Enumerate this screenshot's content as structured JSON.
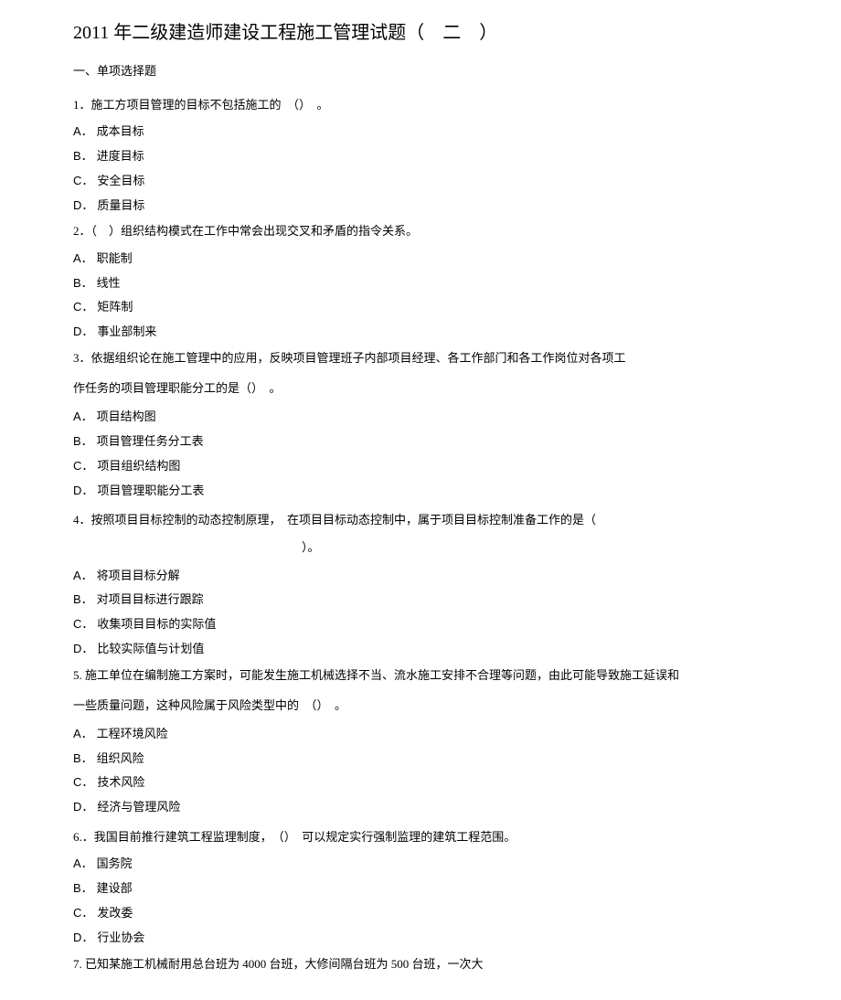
{
  "title": "2011 年二级建造师建设工程施工管理试题（　二　）",
  "section_heading": "一、单项选择题",
  "questions": [
    {
      "text": "1．施工方项目管理的目标不包括施工的　（）　。",
      "options": [
        {
          "letter": "A．",
          "text": "成本目标"
        },
        {
          "letter": "B．",
          "text": "进度目标"
        },
        {
          "letter": "C．",
          "text": "安全目标"
        },
        {
          "letter": "D．",
          "text": "质量目标"
        }
      ]
    },
    {
      "text": "2．（　）组织结构模式在工作中常会出现交叉和矛盾的指令关系。",
      "options": [
        {
          "letter": "A．",
          "text": "职能制"
        },
        {
          "letter": "B．",
          "text": "线性"
        },
        {
          "letter": "C．",
          "text": "矩阵制"
        },
        {
          "letter": "D．",
          "text": "事业部制来"
        }
      ]
    },
    {
      "text": "3．依据组织论在施工管理中的应用，反映项目管理班子内部项目经理、各工作部门和各工作岗位对各项工",
      "continuation": "作任务的项目管理职能分工的是（）　。",
      "options": [
        {
          "letter": "A．",
          "text": "项目结构图"
        },
        {
          "letter": "B．",
          "text": "项目管理任务分工表"
        },
        {
          "letter": "C．",
          "text": "项目组织结构图"
        },
        {
          "letter": "D．",
          "text": "项目管理职能分工表"
        }
      ]
    },
    {
      "text": "4．按照项目目标控制的动态控制原理，　在项目目标动态控制中，属于项目目标控制准备工作的是（",
      "blank_line": "）。",
      "options": [
        {
          "letter": "A．",
          "text": "将项目目标分解"
        },
        {
          "letter": "B．",
          "text": "对项目目标进行跟踪"
        },
        {
          "letter": "C．",
          "text": "收集项目目标的实际值"
        },
        {
          "letter": "D．",
          "text": "比较实际值与计划值"
        }
      ]
    },
    {
      "text": "5. 施工单位在编制施工方案时，可能发生施工机械选择不当、流水施工安排不合理等问题，由此可能导致施工延误和",
      "continuation": "一些质量问题，这种风险属于风险类型中的　（）　。",
      "options": [
        {
          "letter": "A．",
          "text": "工程环境风险"
        },
        {
          "letter": "B．",
          "text": "组织风险"
        },
        {
          "letter": "C．",
          "text": "技术风险"
        },
        {
          "letter": "D．",
          "text": "经济与管理风险"
        }
      ]
    },
    {
      "text": "6.．我国目前推行建筑工程监理制度，　（）　可以规定实行强制监理的建筑工程范围。",
      "options": [
        {
          "letter": "A．",
          "text": "国务院"
        },
        {
          "letter": "B．",
          "text": "建设部"
        },
        {
          "letter": "C．",
          "text": "发改委"
        },
        {
          "letter": "D．",
          "text": "行业协会"
        }
      ]
    },
    {
      "text": "7. 已知某施工机械耐用总台班为 4000 台班，大修间隔台班为 500 台班，一次大"
    }
  ]
}
